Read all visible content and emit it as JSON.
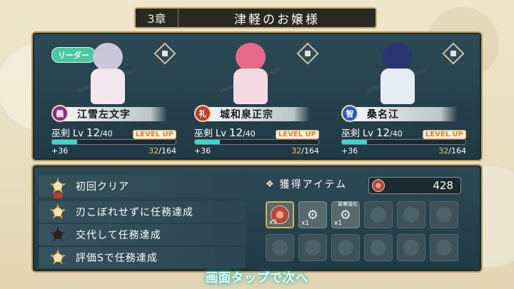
{
  "header": {
    "chapter": "3章",
    "stage_name": "津軽のお嬢様"
  },
  "leader_tag": "リーダー",
  "colors": {
    "accent_gold": "#c9ab6a",
    "exp_fill": "#3dd7c8",
    "levelup_orange": "#f07a2a",
    "panel_teal": "#2c4a55"
  },
  "characters": [
    {
      "name": "江雪左文字",
      "type_icon": "義",
      "type_color": "#8a2a8a",
      "class_label": "巫剣",
      "lv_label": "Lv",
      "level": "12",
      "level_max": "/40",
      "levelup": "LEVEL UP",
      "exp_gain": "+36",
      "exp_current": "32",
      "exp_total": "/164",
      "exp_progress": 0.2
    },
    {
      "name": "城和泉正宗",
      "type_icon": "礼",
      "type_color": "#c23a2a",
      "class_label": "巫剣",
      "lv_label": "Lv",
      "level": "12",
      "level_max": "/40",
      "levelup": "LEVEL UP",
      "exp_gain": "+36",
      "exp_current": "32",
      "exp_total": "/164",
      "exp_progress": 0.2
    },
    {
      "name": "桑名江",
      "type_icon": "智",
      "type_color": "#2a5ac2",
      "class_label": "巫剣",
      "lv_label": "Lv",
      "level": "12",
      "level_max": "/40",
      "levelup": "LEVEL UP",
      "exp_gain": "+36",
      "exp_current": "32",
      "exp_total": "/164",
      "exp_progress": 0.2
    }
  ],
  "missions": [
    {
      "label": "初回クリア",
      "medal": "gold"
    },
    {
      "label": "刃こぼれせずに任務達成",
      "medal": "gold"
    },
    {
      "label": "交代して任務達成",
      "medal": "dark"
    },
    {
      "label": "評価Sで任務達成",
      "medal": "gold"
    }
  ],
  "items": {
    "title": "獲得アイテム",
    "count": "428",
    "slots": [
      {
        "state": "filled",
        "icon": "coin-icon",
        "qty": "x5",
        "tag": ""
      },
      {
        "state": "filled",
        "icon": "gear-icon",
        "qty": "x1",
        "tag": ""
      },
      {
        "state": "filled",
        "icon": "gear-icon",
        "qty": "x1",
        "tag": "装備強化"
      }
    ]
  },
  "footer": {
    "tap_next": "画面タップで次へ"
  }
}
